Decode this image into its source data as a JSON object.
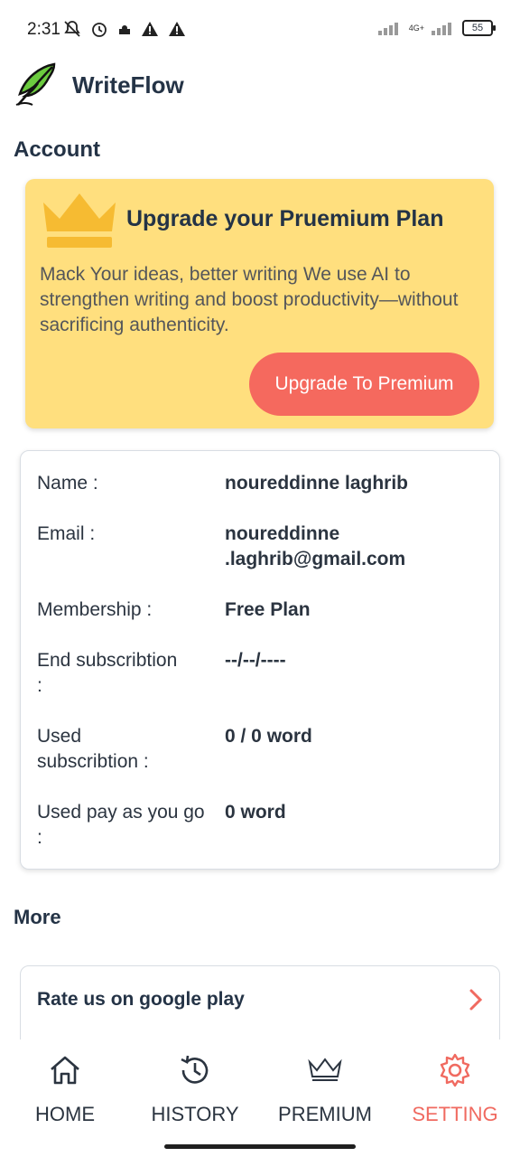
{
  "status_bar": {
    "time": "2:31",
    "network": "4G+",
    "battery": "55"
  },
  "app": {
    "name": "WriteFlow",
    "logo_icon": "feather-icon"
  },
  "account": {
    "section_title": "Account",
    "premium": {
      "title": "Upgrade your Pruemium Plan",
      "description": "Mack Your ideas, better writing We use AI to strengthen writing and boost productivity—without sacrificing authenticity.",
      "button_label": "Upgrade To Premium",
      "accent": "#f5695e",
      "card_color": "#ffdf7e"
    },
    "info": [
      {
        "label": "Name :",
        "value": "noureddinne laghrib"
      },
      {
        "label": "Email :",
        "value": "noureddinne .laghrib@gmail.com"
      },
      {
        "label": "Membership :",
        "value": "Free Plan"
      },
      {
        "label": "End subscribtion :",
        "value": "--/--/----"
      },
      {
        "label": "Used subscribtion :",
        "value": "0 / 0 word"
      },
      {
        "label": "Used pay as you go :",
        "value": "0 word"
      }
    ]
  },
  "more": {
    "section_title": "More",
    "items": [
      {
        "label": "Rate us on google play"
      }
    ]
  },
  "nav": {
    "items": [
      {
        "label": "HOME",
        "icon": "home-icon"
      },
      {
        "label": "HISTORY",
        "icon": "history-icon"
      },
      {
        "label": "PREMIUM",
        "icon": "crown-icon"
      },
      {
        "label": "SETTING",
        "icon": "gear-icon",
        "active": true
      }
    ],
    "active_color": "#f06a60"
  }
}
